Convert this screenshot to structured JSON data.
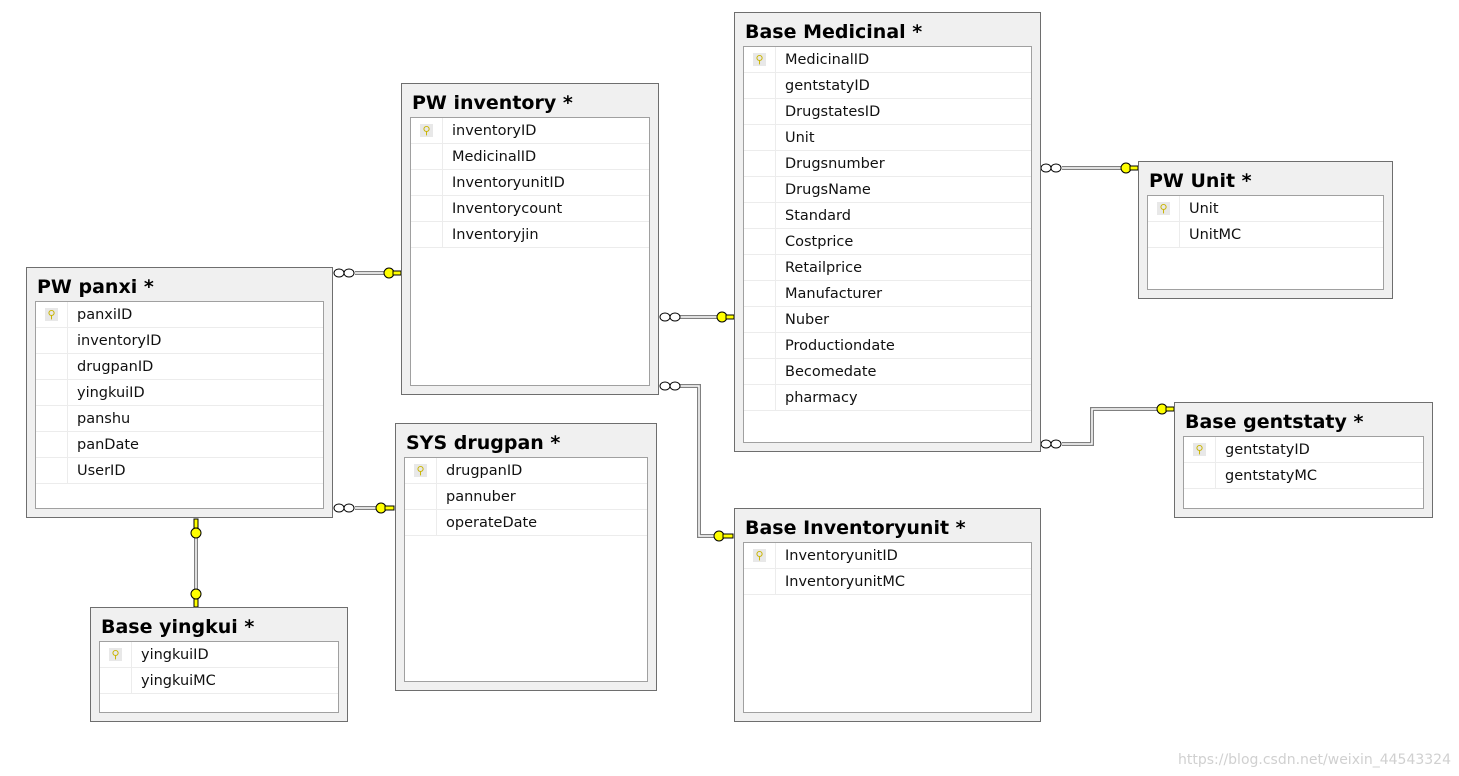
{
  "tables": [
    {
      "id": "pw-panxi",
      "title": "PW panxi *",
      "columns": [
        "panxiID",
        "inventoryID",
        "drugpanID",
        "yingkuiID",
        "panshu",
        "panDate",
        "UserID"
      ],
      "pk": 0
    },
    {
      "id": "pw-inventory",
      "title": "PW inventory *",
      "columns": [
        "inventoryID",
        "MedicinalID",
        "InventoryunitID",
        "Inventorycount",
        "Inventoryjin"
      ],
      "pk": 0
    },
    {
      "id": "base-medicinal",
      "title": "Base Medicinal *",
      "columns": [
        "MedicinalID",
        "gentstatyID",
        "DrugstatesID",
        "Unit",
        "Drugsnumber",
        "DrugsName",
        "Standard",
        "Costprice",
        "Retailprice",
        "Manufacturer",
        "Nuber",
        "Productiondate",
        "Becomedate",
        "pharmacy"
      ],
      "pk": 0
    },
    {
      "id": "pw-unit",
      "title": "PW Unit *",
      "columns": [
        "Unit",
        "UnitMC"
      ],
      "pk": 0
    },
    {
      "id": "base-gentstaty",
      "title": "Base gentstaty *",
      "columns": [
        "gentstatyID",
        "gentstatyMC"
      ],
      "pk": 0
    },
    {
      "id": "sys-drugpan",
      "title": "SYS drugpan *",
      "columns": [
        "drugpanID",
        "pannuber",
        "operateDate"
      ],
      "pk": 0
    },
    {
      "id": "base-inventoryunit",
      "title": "Base Inventoryunit *",
      "columns": [
        "InventoryunitID",
        "InventoryunitMC"
      ],
      "pk": 0
    },
    {
      "id": "base-yingkui",
      "title": "Base yingkui *",
      "columns": [
        "yingkuiID",
        "yingkuiMC"
      ],
      "pk": 0
    }
  ],
  "icons": {
    "primary_key": "key-icon",
    "relationship_many": "infinity-icon",
    "relationship_one": "key-icon"
  },
  "colors": {
    "key": "#ffff00",
    "line": "#808080",
    "panel": "#f0f0f0"
  },
  "watermark": "https://blog.csdn.net/weixin_44543324"
}
